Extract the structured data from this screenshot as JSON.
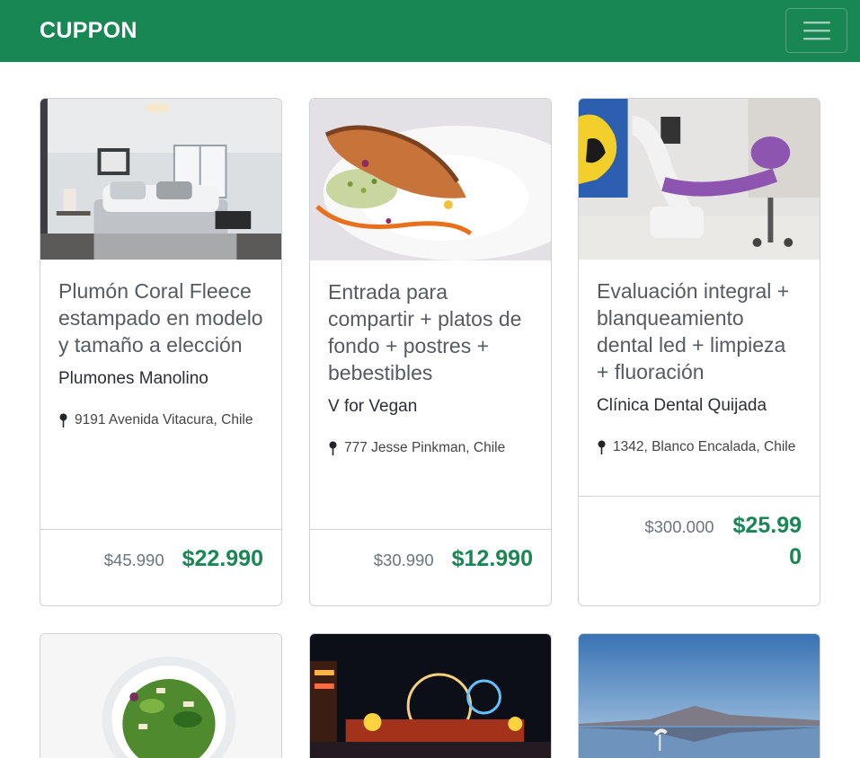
{
  "navbar": {
    "brand": "CUPPON",
    "menu_icon": "hamburger-menu-icon"
  },
  "colors": {
    "brand": "#198754",
    "price": "#198754",
    "old_price": "#6c757d"
  },
  "offers": [
    {
      "title": "Plumón Coral Fleece estampado en modelo y tamaño a elección",
      "vendor": "Plumones Manolino",
      "address": "9191 Avenida Vitacura, Chile",
      "old_price": "$45.990",
      "price": "$22.990",
      "image": "bedroom"
    },
    {
      "title": "Entrada para compartir + platos de fondo + postres + bebestibles",
      "vendor": "V for Vegan",
      "address": "777 Jesse Pinkman, Chile",
      "old_price": "$30.990",
      "price": "$12.990",
      "image": "salmon-dish"
    },
    {
      "title": "Evaluación integral + blanqueamiento dental led + limpieza + fluoración",
      "vendor": "Clínica Dental Quijada",
      "address": "1342, Blanco Encalada, Chile",
      "old_price": "$300.000",
      "price_line1": "$25.99",
      "price_line2": "0",
      "image": "dental-chair"
    }
  ],
  "more_offers_images": [
    "green-salad",
    "night-carnival",
    "flamingo-lake"
  ]
}
